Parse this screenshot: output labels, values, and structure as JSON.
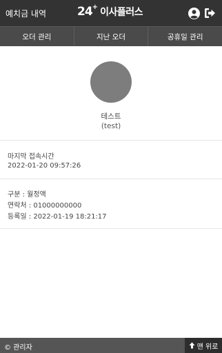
{
  "header": {
    "deposit_label": "예치금 내역",
    "brand_number": "24",
    "brand_plus": "+",
    "brand_name": "이사플러스",
    "profile_icon": "user-circle-icon",
    "logout_icon": "sign-out-icon"
  },
  "nav": {
    "tabs": [
      {
        "label": "오더 관리"
      },
      {
        "label": "지난 오더"
      },
      {
        "label": "공휴일 관리"
      }
    ]
  },
  "profile": {
    "name": "테스트",
    "id": "(test)"
  },
  "last_access": {
    "label": "마지막 접속시간",
    "value": "2022-01-20 09:57:26"
  },
  "account": {
    "type": "구분 : 월정액",
    "contact": "연락처 : 01000000000",
    "registered": "등록일 : 2022-01-19 18:21:17"
  },
  "footer": {
    "copyright": "© 관리자",
    "to_top_label": "맨 위로",
    "to_top_icon": "arrow-up-icon"
  },
  "colors": {
    "topbar": "#333333",
    "navbar": "#4a4a4a",
    "avatar": "#7d7d7d",
    "footer": "#555555",
    "to_top": "#2d2d2d"
  }
}
